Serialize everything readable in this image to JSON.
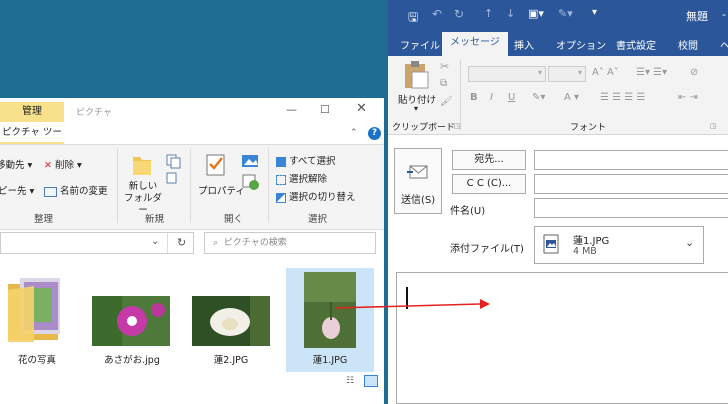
{
  "explorer": {
    "manage_tab": "管理",
    "window_title": "ピクチャ",
    "picture_tools_tab": "ピクチャ ツール",
    "ribbon": {
      "move_to": "移動先",
      "delete": "削除",
      "copy_to": "ピー先",
      "rename": "名前の変更",
      "organize_label": "整理",
      "new_folder": "新しい\nフォルダー",
      "new_label": "新規",
      "properties": "プロパティ",
      "open_label": "開く",
      "select_all": "すべて選択",
      "select_none": "選択解除",
      "invert_selection": "選択の切り替え",
      "select_label": "選択"
    },
    "search_placeholder": "ピクチャの検索",
    "files": [
      {
        "name": "花の写真"
      },
      {
        "name": "あさがお.jpg"
      },
      {
        "name": "蓮2.JPG"
      },
      {
        "name": "蓮1.JPG"
      }
    ]
  },
  "outlook": {
    "title": "無題",
    "tabs": [
      "ファイル",
      "メッセージ",
      "挿入",
      "オプション",
      "書式設定",
      "校閲",
      "ヘ"
    ],
    "active_tab_index": 1,
    "paste_label": "貼り付け",
    "clipboard_label": "クリップボード",
    "font_label": "フォント",
    "send_label": "送信(S)",
    "to_label": "宛先...",
    "cc_label": "C C (C)...",
    "subject_label": "件名(U)",
    "attachment_label": "添付ファイル(T)",
    "attachment": {
      "name": "蓮1.JPG",
      "size": "4 MB"
    }
  },
  "colors": {
    "outlook_blue": "#2b579a",
    "manage_yellow": "#f7e18a",
    "desktop": "#1f6c92",
    "arrow": "#e52222"
  }
}
